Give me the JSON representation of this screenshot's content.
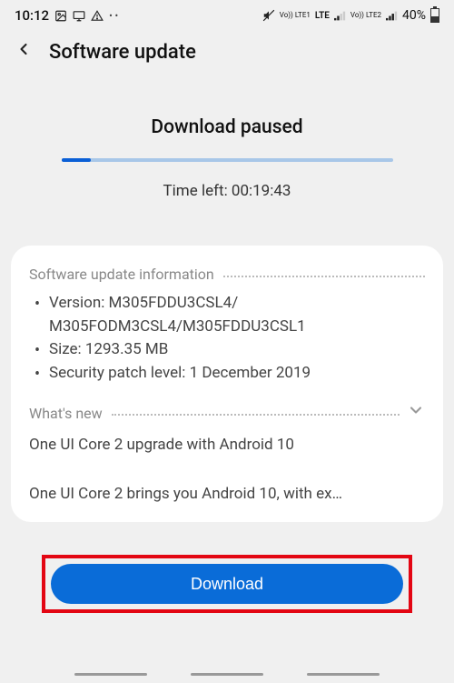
{
  "status": {
    "time": "10:12",
    "battery_pct": "40%",
    "lte1": "Vo)) LTE1",
    "lte2": "Vo)) LTE2",
    "lte_text": "LTE"
  },
  "header": {
    "title": "Software update"
  },
  "paused": {
    "title": "Download paused",
    "time_left": "Time left: 00:19:43"
  },
  "info": {
    "section_label": "Software update information",
    "version_label": "Version: M305FDDU3CSL4/",
    "version_cont": "M305FODM3CSL4/M305FDDU3CSL1",
    "size": "Size: 1293.35 MB",
    "security": "Security patch level: 1 December 2019"
  },
  "whatsnew": {
    "section_label": "What's new",
    "line1": "One UI Core 2 upgrade with Android 10",
    "line2": "One UI Core 2 brings you Android 10, with ex…"
  },
  "download_label": "Download"
}
